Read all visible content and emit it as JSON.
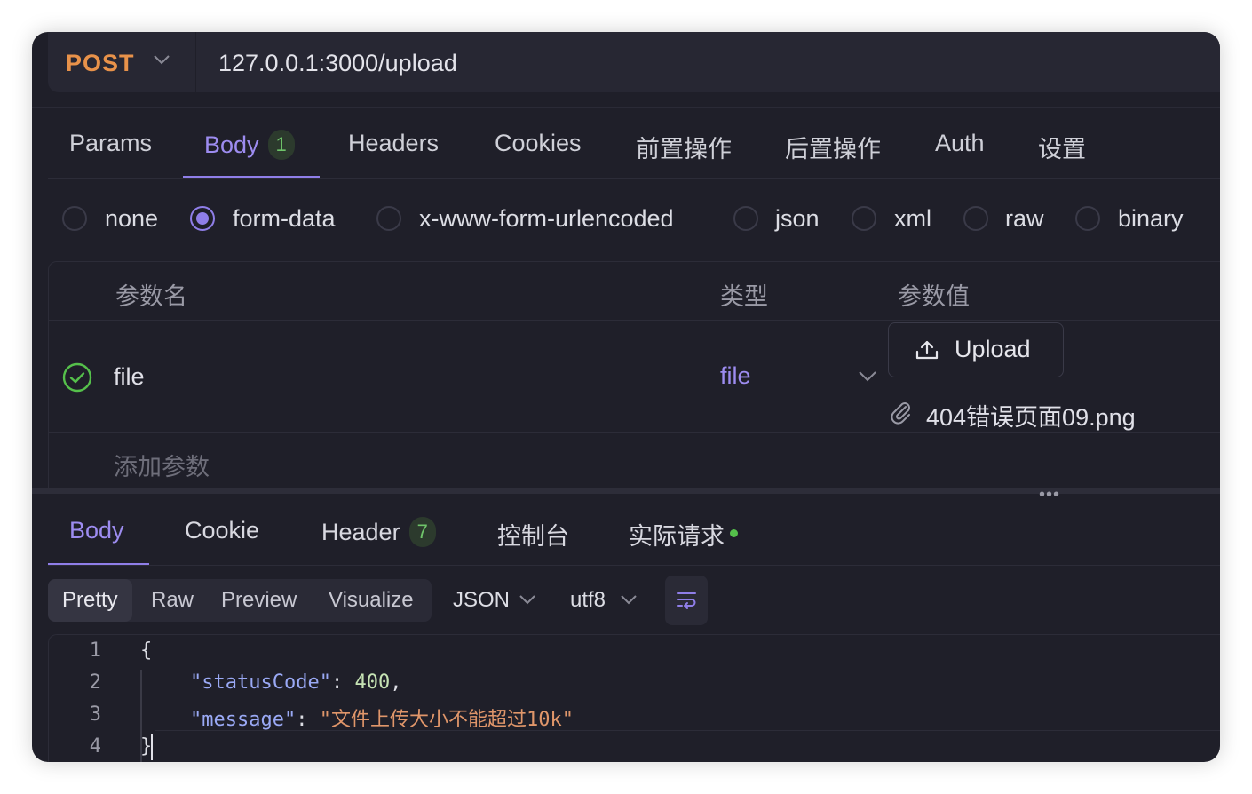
{
  "request": {
    "method": "POST",
    "url": "127.0.0.1:3000/upload"
  },
  "request_tabs": [
    {
      "label": "Params",
      "badge": ""
    },
    {
      "label": "Body",
      "badge": "1"
    },
    {
      "label": "Headers",
      "badge": ""
    },
    {
      "label": "Cookies",
      "badge": ""
    },
    {
      "label": "前置操作",
      "badge": ""
    },
    {
      "label": "后置操作",
      "badge": ""
    },
    {
      "label": "Auth",
      "badge": ""
    },
    {
      "label": "设置",
      "badge": ""
    }
  ],
  "body_types": {
    "options": [
      "none",
      "form-data",
      "x-www-form-urlencoded",
      "json",
      "xml",
      "raw",
      "binary"
    ],
    "selected": "form-data"
  },
  "params_table": {
    "headers": [
      "参数名",
      "类型",
      "参数值"
    ],
    "rows": [
      {
        "enabled": true,
        "name": "file",
        "type": "file",
        "upload_label": "Upload",
        "file_name": "404错误页面09.png"
      }
    ],
    "add_placeholder": "添加参数"
  },
  "response_tabs": [
    {
      "label": "Body",
      "badge": ""
    },
    {
      "label": "Cookie",
      "badge": ""
    },
    {
      "label": "Header",
      "badge": "7"
    },
    {
      "label": "控制台",
      "badge": ""
    },
    {
      "label": "实际请求",
      "badge": ""
    }
  ],
  "view_modes": [
    "Pretty",
    "Raw",
    "Preview",
    "Visualize"
  ],
  "selected_view": "Pretty",
  "format": "JSON",
  "encoding": "utf8",
  "code": {
    "line_numbers": [
      "1",
      "2",
      "3",
      "4"
    ],
    "open_brace": "{",
    "close_brace": "}",
    "key1": "\"statusCode\"",
    "value1": "400",
    "key2": "\"message\"",
    "value2": "\"文件上传大小不能超过10k\""
  },
  "colors": {
    "accent": "#8f7ee8",
    "method": "#e8924a",
    "success": "#55c04b",
    "background": "#1f1f29"
  }
}
